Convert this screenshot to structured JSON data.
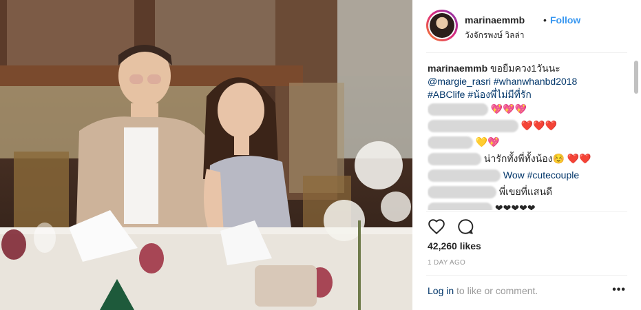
{
  "post": {
    "username": "marinaemmb",
    "follow_label": "Follow",
    "dot": "•",
    "location": "วังจักรพงษ์ วิลล่า",
    "caption_user": "marinaemmb",
    "caption_text": "ขอยืมควง1วันนะ",
    "caption_tags_line2": "@margie_rasri #whanwhanbd2018",
    "caption_tags_line3": "#ABClife #น้องพี่ไม่มีที่รัก",
    "comments": [
      {
        "text": "💖💖💖"
      },
      {
        "text": "❤️❤️❤️"
      },
      {
        "text": "💛💖"
      },
      {
        "text": "น่ารักทั้งพี่ทั้งน้อง☺️ ❤️❤️"
      },
      {
        "text": "Wow #cutecouple"
      },
      {
        "text": "พี่เขยที่แสนดี"
      },
      {
        "text": "❤❤❤❤❤"
      }
    ],
    "likes": "42,260 likes",
    "date": "1 DAY AGO",
    "login_link": "Log in",
    "login_rest": " to like or comment.",
    "more": "•••"
  },
  "colors": {
    "link": "#3897f0",
    "tag": "#003569",
    "meta": "#999999"
  },
  "icons": [
    "heart-icon",
    "comment-icon",
    "more-options-icon"
  ]
}
